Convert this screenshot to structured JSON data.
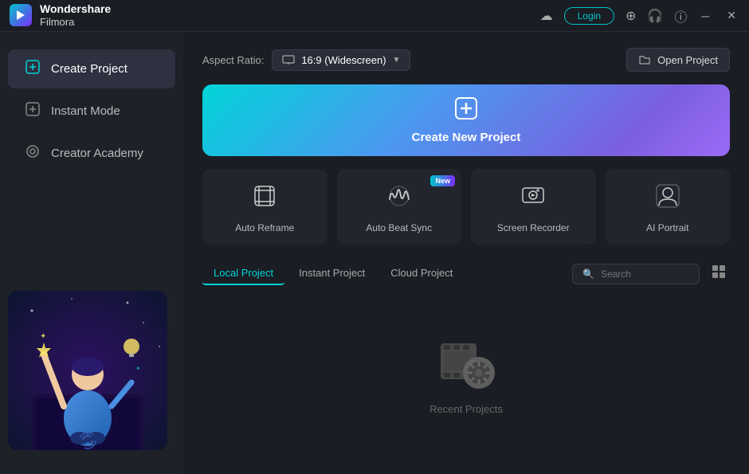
{
  "app": {
    "name_line1": "Wondershare",
    "name_line2": "Filmora"
  },
  "titlebar": {
    "login_label": "Login",
    "minimize_symbol": "─",
    "close_symbol": "✕",
    "cloud_symbol": "☁",
    "download_symbol": "⊕",
    "headphones_symbol": "🎧",
    "info_symbol": "ⓘ"
  },
  "sidebar": {
    "items": [
      {
        "id": "create-project",
        "label": "Create Project",
        "icon": "⊞",
        "active": true
      },
      {
        "id": "instant-mode",
        "label": "Instant Mode",
        "icon": "⊞",
        "active": false
      },
      {
        "id": "creator-academy",
        "label": "Creator Academy",
        "icon": "◎",
        "active": false
      }
    ]
  },
  "content": {
    "aspect_ratio_label": "Aspect Ratio:",
    "aspect_ratio_value": "16:9 (Widescreen)",
    "open_project_label": "Open Project",
    "create_new_project_label": "Create New Project",
    "feature_cards": [
      {
        "id": "auto-reframe",
        "label": "Auto Reframe",
        "icon": "⊡",
        "badge": null
      },
      {
        "id": "auto-beat-sync",
        "label": "Auto Beat Sync",
        "icon": "♪",
        "badge": "New"
      },
      {
        "id": "screen-recorder",
        "label": "Screen Recorder",
        "icon": "⊙",
        "badge": null
      },
      {
        "id": "ai-portrait",
        "label": "AI Portrait",
        "icon": "👤",
        "badge": null
      }
    ],
    "project_tabs": [
      {
        "id": "local",
        "label": "Local Project",
        "active": true
      },
      {
        "id": "instant",
        "label": "Instant Project",
        "active": false
      },
      {
        "id": "cloud",
        "label": "Cloud Project",
        "active": false
      }
    ],
    "search_placeholder": "Search",
    "empty_state_label": "Recent Projects",
    "view_grid_icon": "⊞"
  }
}
